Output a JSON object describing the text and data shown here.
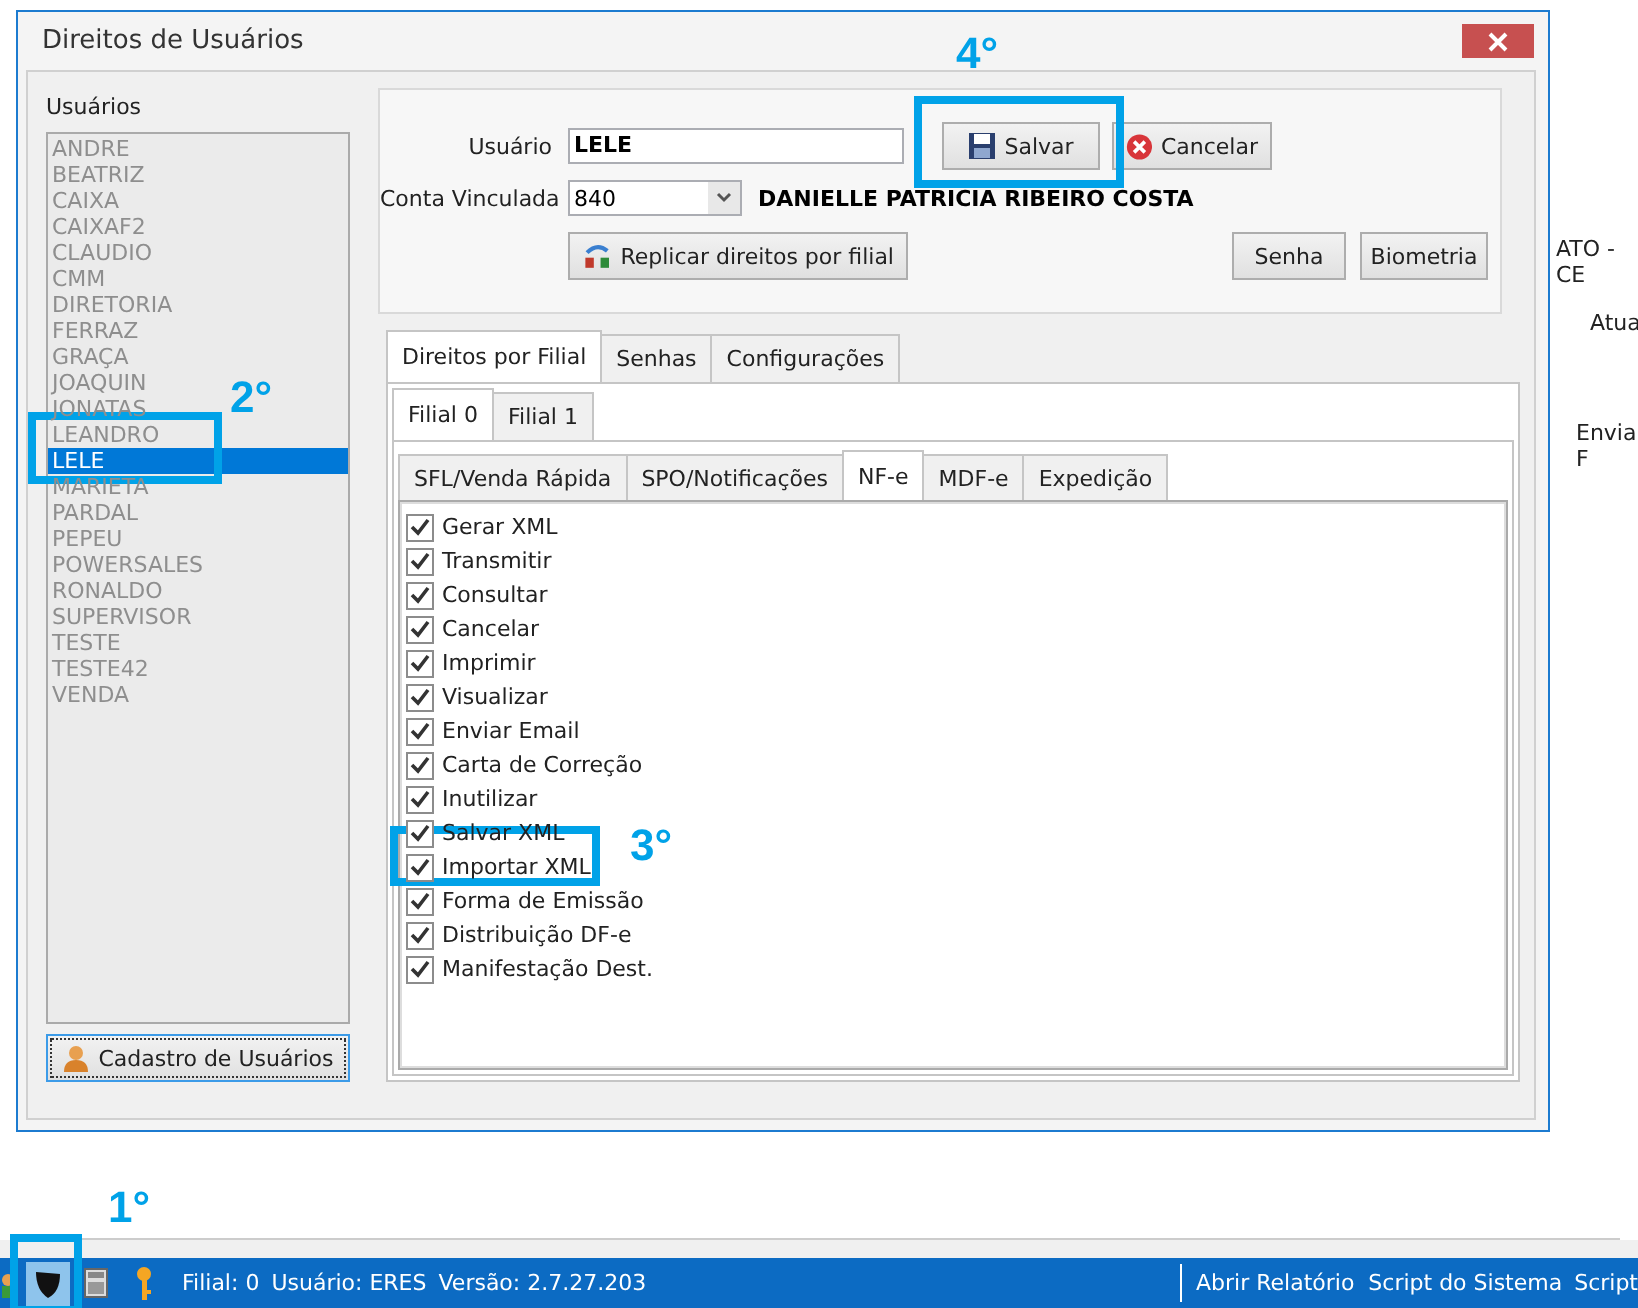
{
  "window": {
    "title": "Direitos de Usuários"
  },
  "users": {
    "label": "Usuários",
    "items": [
      {
        "name": "ANDRE",
        "selected": false
      },
      {
        "name": "BEATRIZ",
        "selected": false
      },
      {
        "name": "CAIXA",
        "selected": false
      },
      {
        "name": "CAIXAF2",
        "selected": false
      },
      {
        "name": "CLAUDIO",
        "selected": false
      },
      {
        "name": "CMM",
        "selected": false
      },
      {
        "name": "DIRETORIA",
        "selected": false
      },
      {
        "name": "FERRAZ",
        "selected": false
      },
      {
        "name": "GRAÇA",
        "selected": false
      },
      {
        "name": "JOAQUIN",
        "selected": false
      },
      {
        "name": "JONATAS",
        "selected": false
      },
      {
        "name": "LEANDRO",
        "selected": false
      },
      {
        "name": "LELE",
        "selected": true
      },
      {
        "name": "MARIETA",
        "selected": false
      },
      {
        "name": "PARDAL",
        "selected": false
      },
      {
        "name": "PEPEU",
        "selected": false
      },
      {
        "name": "POWERSALES",
        "selected": false
      },
      {
        "name": "RONALDO",
        "selected": false
      },
      {
        "name": "SUPERVISOR",
        "selected": false
      },
      {
        "name": "TESTE",
        "selected": false
      },
      {
        "name": "TESTE42",
        "selected": false
      },
      {
        "name": "VENDA",
        "selected": false
      }
    ],
    "button": "Cadastro de Usuários"
  },
  "form": {
    "user_label": "Usuário",
    "user_value": "LELE",
    "account_label": "Conta Vinculada",
    "account_value": "840",
    "account_name": "DANIELLE PATRICIA RIBEIRO COSTA",
    "save": "Salvar",
    "cancel": "Cancelar",
    "replicate": "Replicar direitos por filial",
    "password": "Senha",
    "biometrics": "Biometria"
  },
  "tabs": [
    {
      "label": "Direitos por Filial",
      "selected": true
    },
    {
      "label": "Senhas",
      "selected": false
    },
    {
      "label": "Configurações",
      "selected": false
    }
  ],
  "branch_tabs": [
    {
      "label": "Filial 0",
      "selected": true
    },
    {
      "label": "Filial 1",
      "selected": false
    }
  ],
  "module_tabs": [
    {
      "label": "SFL/Venda Rápida",
      "selected": false
    },
    {
      "label": "SPO/Notificações",
      "selected": false
    },
    {
      "label": "NF-e",
      "selected": true
    },
    {
      "label": "MDF-e",
      "selected": false
    },
    {
      "label": "Expedição",
      "selected": false
    }
  ],
  "permissions": [
    {
      "label": "Gerar XML",
      "checked": true
    },
    {
      "label": "Transmitir",
      "checked": true
    },
    {
      "label": "Consultar",
      "checked": true
    },
    {
      "label": "Cancelar",
      "checked": true
    },
    {
      "label": "Imprimir",
      "checked": true
    },
    {
      "label": "Visualizar",
      "checked": true
    },
    {
      "label": "Enviar Email",
      "checked": true
    },
    {
      "label": "Carta de Correção",
      "checked": true
    },
    {
      "label": "Inutilizar",
      "checked": true
    },
    {
      "label": "Salvar XML",
      "checked": true
    },
    {
      "label": "Importar XML",
      "checked": true
    },
    {
      "label": "Forma de Emissão",
      "checked": true
    },
    {
      "label": "Distribuição DF-e",
      "checked": true
    },
    {
      "label": "Manifestação Dest.",
      "checked": true
    }
  ],
  "background": [
    "ATO - CE",
    "Atua",
    "Envia F"
  ],
  "status_bar": {
    "info": [
      "Filial: 0",
      "Usuário: ERES",
      "Versão: 2.7.27.203"
    ],
    "links": [
      "Abrir Relatório",
      "Script do Sistema",
      "Script"
    ]
  },
  "annotations": [
    {
      "label": "1°"
    },
    {
      "label": "2°"
    },
    {
      "label": "3°"
    },
    {
      "label": "4°"
    }
  ]
}
